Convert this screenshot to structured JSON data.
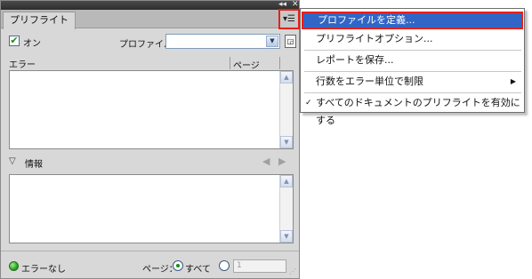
{
  "panel": {
    "tab_label": "プリフライト",
    "window_controls": [
      "◂◂",
      "✕"
    ],
    "tab_close": "✕",
    "menu_icon": "▾☰",
    "on_checkbox_label": "オン",
    "profile_label": "プロファイル：",
    "profile_value": "",
    "columns": {
      "error": "エラー",
      "page": "ページ"
    },
    "info_label": "情報",
    "status_text": "エラーなし",
    "page_label": "ページ：",
    "all_label": "すべて",
    "page_field_value": "1"
  },
  "icons": {
    "check": "✔",
    "select_arrow": "▼",
    "profile_doc": "◲",
    "scroll_up": "▲",
    "scroll_down": "▼",
    "info_toggle": "▽",
    "prev": "◀",
    "next": "▶",
    "grip": "⋰"
  },
  "menu": {
    "items": [
      {
        "label": "プロファイルを定義..."
      },
      {
        "label": "プリフライトオプション..."
      },
      {
        "label": "レポートを保存..."
      },
      {
        "label": "行数をエラー単位で制限",
        "submenu_arrow": "▶"
      },
      {
        "label": "すべてのドキュメントのプリフライトを有効にする",
        "check": "✓"
      }
    ]
  },
  "colors": {
    "highlight": "#3166c6",
    "callout": "#e8201a",
    "status_ok": "#1a9a14"
  }
}
